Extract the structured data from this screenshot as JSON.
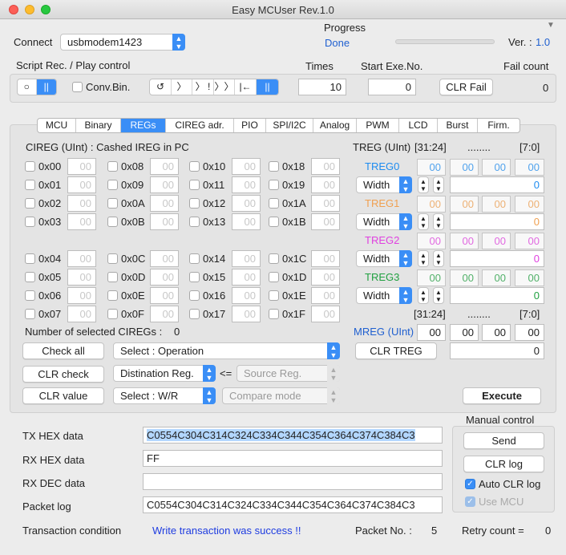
{
  "window": {
    "title": "Easy MCUser Rev.1.0"
  },
  "connect": {
    "label": "Connect",
    "port": "usbmodem1423"
  },
  "progress": {
    "label": "Progress",
    "status": "Done"
  },
  "version": {
    "label": "Ver. :",
    "value": "1.0"
  },
  "script": {
    "label": "Script Rec. / Play control",
    "conv_label": "Conv.Bin.",
    "rec_buttons": [
      "○",
      "||"
    ],
    "play_buttons": [
      "↺",
      "〉",
      "〉 !",
      "〉〉",
      "|←",
      "||"
    ]
  },
  "times": {
    "label": "Times",
    "value": "10"
  },
  "start_exe": {
    "label": "Start Exe.No.",
    "value": "0"
  },
  "fail": {
    "label": "Fail count",
    "value": "0",
    "clr": "CLR Fail"
  },
  "tabs": [
    "MCU",
    "Binary",
    "REGs",
    "CIREG adr.",
    "PIO",
    "SPI/I2C",
    "Analog",
    "PWM",
    "LCD",
    "Burst",
    "Firm."
  ],
  "cireg": {
    "title": "CIREG (UInt) : Cashed IREG in PC",
    "group1": [
      [
        "0x00",
        "0x08",
        "0x10",
        "0x18"
      ],
      [
        "0x01",
        "0x09",
        "0x11",
        "0x19"
      ],
      [
        "0x02",
        "0x0A",
        "0x12",
        "0x1A"
      ],
      [
        "0x03",
        "0x0B",
        "0x13",
        "0x1B"
      ]
    ],
    "group2": [
      [
        "0x04",
        "0x0C",
        "0x14",
        "0x1C"
      ],
      [
        "0x05",
        "0x0D",
        "0x15",
        "0x1D"
      ],
      [
        "0x06",
        "0x0E",
        "0x16",
        "0x1E"
      ],
      [
        "0x07",
        "0x0F",
        "0x17",
        "0x1F"
      ]
    ],
    "value": "00",
    "selected_label": "Number of selected CIREGs :",
    "selected_count": "0"
  },
  "ops": {
    "check_all": "Check all",
    "clr_check": "CLR check",
    "clr_value": "CLR value",
    "operation": "Select : Operation",
    "dest": "Distination Reg.",
    "arrow": "<=",
    "source": "Source Reg.",
    "wr": "Select : W/R",
    "compare": "Compare mode"
  },
  "treg": {
    "title": "TREG (UInt)",
    "range_hi": "[31:24]",
    "dots": "........",
    "range_lo": "[7:0]",
    "width_label": "Width",
    "bytes": [
      "00",
      "00",
      "00",
      "00"
    ],
    "items": [
      {
        "name": "TREG0",
        "color": "#1e8cf0",
        "value": "0"
      },
      {
        "name": "TREG1",
        "color": "#f0a050",
        "value": "0"
      },
      {
        "name": "TREG2",
        "color": "#e040e0",
        "value": "0"
      },
      {
        "name": "TREG3",
        "color": "#20a040",
        "value": "0"
      }
    ]
  },
  "mreg": {
    "range_hi": "[31:24]",
    "dots": "........",
    "range_lo": "[7:0]",
    "name": "MREG (UInt)",
    "bytes": [
      "00",
      "00",
      "00",
      "00"
    ],
    "clr": "CLR TREG",
    "value": "0",
    "execute": "Execute"
  },
  "manual": {
    "title": "Manual control",
    "send": "Send",
    "clr_log": "CLR log",
    "auto_clr": "Auto CLR log",
    "use_mcu": "Use MCU"
  },
  "tx": {
    "label": "TX HEX data",
    "value": "C0554C304C314C324C334C344C354C364C374C384C3"
  },
  "rx": {
    "label": "RX HEX data",
    "value": "FF"
  },
  "rxdec": {
    "label": "RX DEC data",
    "value": ""
  },
  "packet_log": {
    "label": "Packet log",
    "value": "C0554C304C314C324C334C344C354C364C374C384C3"
  },
  "status": {
    "label": "Transaction condition",
    "message": "Write transaction was success !!",
    "packet_label": "Packet No. :",
    "packet_no": "5",
    "retry_label": "Retry count  =",
    "retry": "0"
  },
  "colors": {
    "accent": "#3a8ef6",
    "success_text": "#1e3ce0",
    "version": "#2060d0",
    "mreg": "#2060d0"
  }
}
